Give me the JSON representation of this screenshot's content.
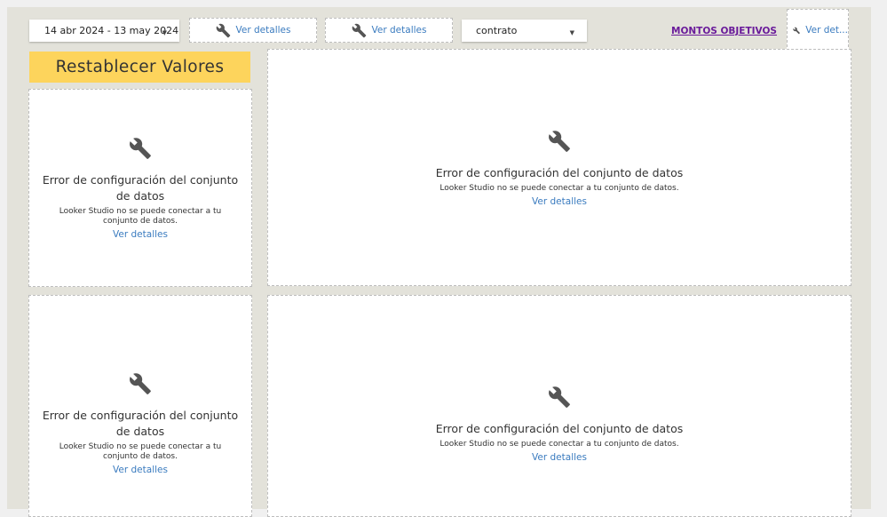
{
  "filters": {
    "date_range": "14 abr 2024 - 13 may 2024",
    "chip1_link": "Ver detalles",
    "chip2_link": "Ver detalles",
    "dimension_select": "contrato",
    "montos_link": "MONTOS OBJETIVOS",
    "chip3_link": "Ver det..."
  },
  "reset_button": {
    "label": "Restablecer Valores"
  },
  "panels": [
    {
      "title": "Error de configuración del conjunto de datos",
      "subtitle": "Looker Studio no se puede conectar a tu conjunto de datos.",
      "link": "Ver detalles"
    },
    {
      "title": "Error de configuración del conjunto de datos",
      "subtitle": "Looker Studio no se puede conectar a tu conjunto de datos.",
      "link": "Ver detalles"
    },
    {
      "title": "Error de configuración del conjunto de datos",
      "subtitle": "Looker Studio no se puede conectar a tu conjunto de datos.",
      "link": "Ver detalles"
    },
    {
      "title": "Error de configuración del conjunto de datos",
      "subtitle": "Looker Studio no se puede conectar a tu conjunto de datos.",
      "link": "Ver detalles"
    }
  ],
  "icons": {
    "error": "wrench-icon",
    "dropdown": "caret-down-icon"
  },
  "colors": {
    "canvas": "#e3e2da",
    "reset_button": "#fdd45c",
    "link": "#3a7bbf",
    "montos": "#6a1b9a"
  }
}
